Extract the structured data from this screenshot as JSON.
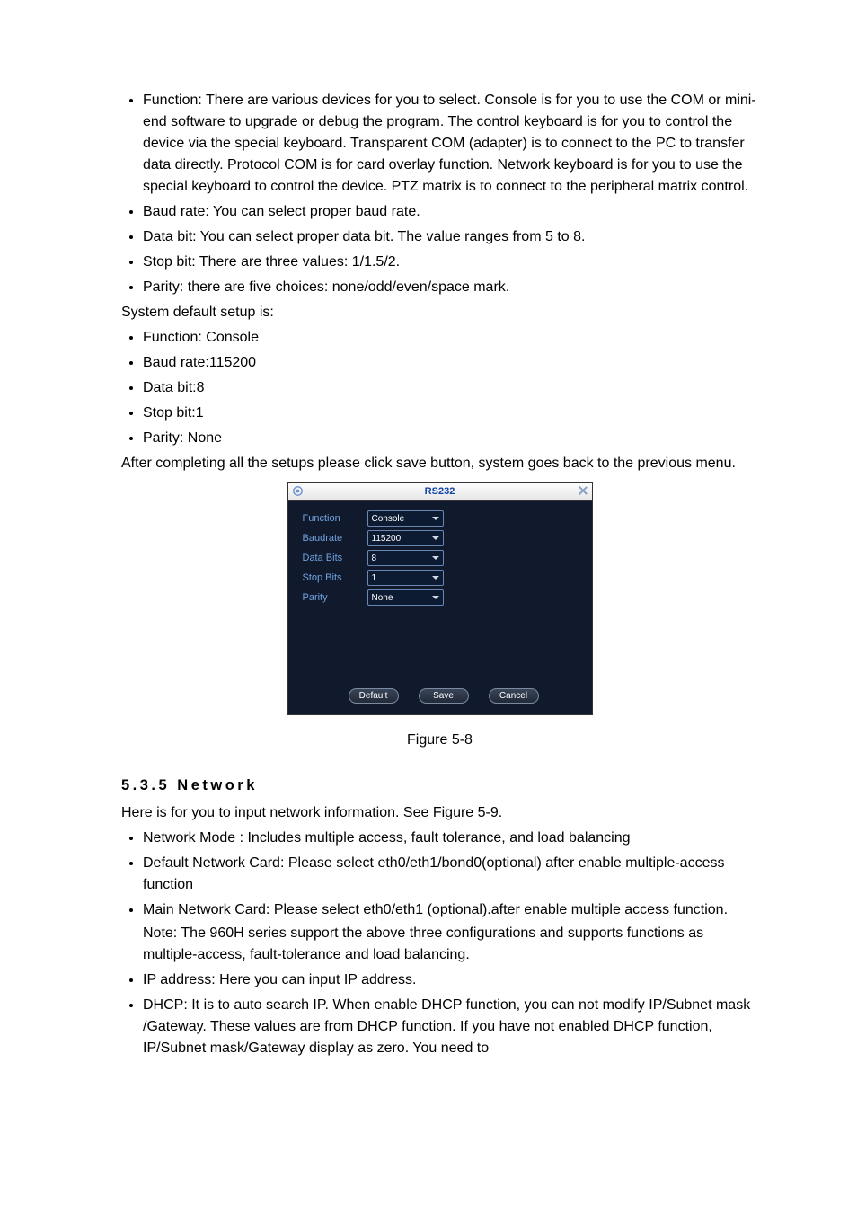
{
  "bullets_top": [
    "Function: There are various devices for you to select. Console is for you to use the COM or mini-end software to upgrade or debug the program. The control keyboard is for you to control the device via the special keyboard. Transparent COM (adapter) is to connect to the PC to transfer data directly. Protocol COM is for card overlay function. Network keyboard is for you to use the special keyboard to control the device. PTZ matrix is to connect to the peripheral matrix control.",
    "Baud rate: You can select proper baud rate.",
    "Data bit: You can select proper data bit. The value ranges from 5 to 8.",
    "Stop bit: There are three values: 1/1.5/2.",
    "Parity: there are five choices: none/odd/even/space mark."
  ],
  "line_sysdefault": "System default setup is:",
  "bullets_defaults": [
    "Function: Console",
    "Baud rate:115200",
    "Data bit:8",
    "Stop bit:1",
    "Parity: None"
  ],
  "line_after": "After completing all the setups please click save button, system goes back to the previous menu.",
  "dialog": {
    "title": "RS232",
    "rows": [
      {
        "label": "Function",
        "value": "Console"
      },
      {
        "label": "Baudrate",
        "value": "115200"
      },
      {
        "label": "Data Bits",
        "value": "8"
      },
      {
        "label": "Stop Bits",
        "value": "1"
      },
      {
        "label": "Parity",
        "value": "None"
      }
    ],
    "buttons": {
      "default": "Default",
      "save": "Save",
      "cancel": "Cancel"
    }
  },
  "figure_caption": "Figure 5-8",
  "section_heading": "5.3.5  Network",
  "section_intro": "Here is for you to input network information. See Figure 5-9.",
  "section_bullets": {
    "b0": "Network Mode : Includes multiple access, fault tolerance, and load balancing",
    "b1": "Default Network Card: Please select eth0/eth1/bond0(optional) after enable multiple-access function",
    "b2": "Main Network Card: Please select eth0/eth1 (optional).after enable multiple access function.",
    "b2_note": "Note: The 960H series support the above three configurations and supports functions as multiple-access, fault-tolerance and load balancing.",
    "b3": "IP address: Here you can input IP address.",
    "b4": "DHCP: It is to auto search IP. When enable DHCP function, you can not modify IP/Subnet mask /Gateway. These values are from DHCP function. If you have not enabled DHCP function, IP/Subnet mask/Gateway display as zero. You need to"
  }
}
